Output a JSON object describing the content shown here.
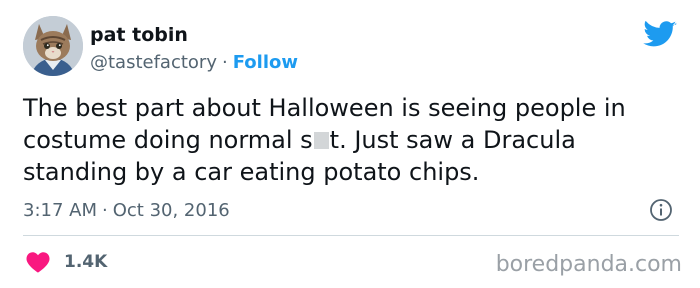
{
  "user": {
    "display_name": "pat tobin",
    "handle": "@tastefactory",
    "separator": "·",
    "follow_label": "Follow",
    "avatar": "kitten-photo"
  },
  "tweet": {
    "lines": [
      [
        "The best part about Halloween is seeing people in"
      ],
      [
        "costume doing normal s",
        "t. Just saw a Dracula"
      ],
      [
        "standing by a car eating potato chips."
      ]
    ],
    "time": "3:17 AM",
    "separator": "·",
    "date": "Oct 30, 2016"
  },
  "engagement": {
    "likes": "1.4K"
  },
  "icons": {
    "brand": "twitter-bird-icon",
    "info": "info-icon",
    "like": "heart-icon"
  },
  "colors": {
    "brand_blue": "#1d9bf0",
    "heart_pink": "#f91880",
    "muted_text": "#536471",
    "divider": "#cfd9de"
  },
  "watermark": "boredpanda.com"
}
